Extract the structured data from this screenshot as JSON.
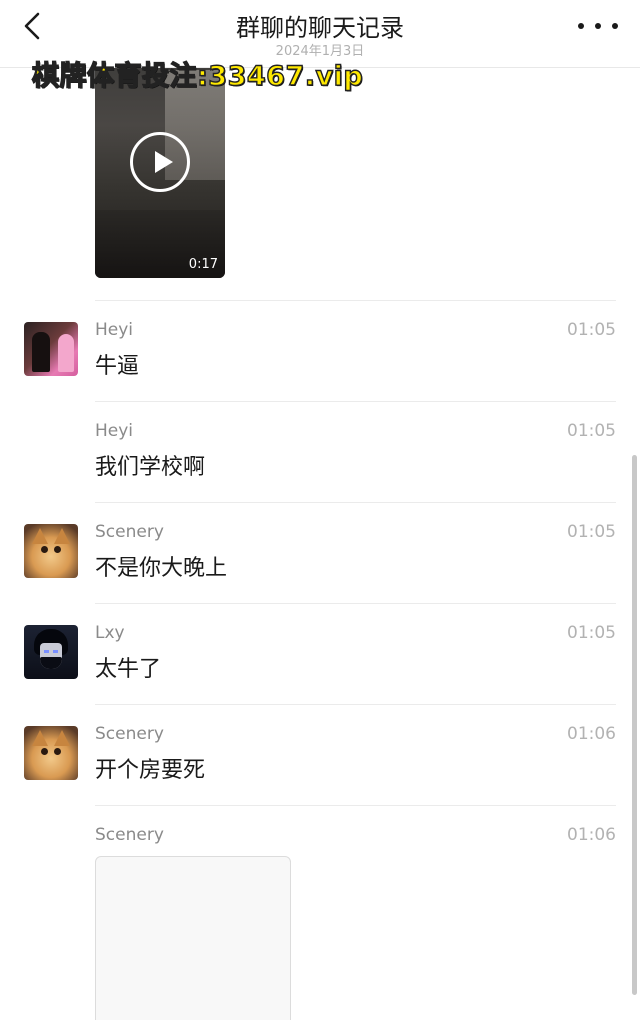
{
  "header": {
    "title": "群聊的聊天记录",
    "subtitle": "2024年1月3日",
    "back_icon": "chevron-left-icon",
    "more_icon": "more-dots-icon"
  },
  "watermark": "棋牌体育投注:33467.vip",
  "video": {
    "duration": "0:17",
    "play_icon": "play-icon"
  },
  "messages": [
    {
      "sender": "Heyi",
      "time": "01:05",
      "text": "牛逼",
      "avatar": "heyi"
    },
    {
      "sender": "Heyi",
      "time": "01:05",
      "text": "我们学校啊"
    },
    {
      "sender": "Scenery",
      "time": "01:05",
      "text": "不是你大晚上",
      "avatar": "scenery"
    },
    {
      "sender": "Lxy",
      "time": "01:05",
      "text": "太牛了",
      "avatar": "lxy"
    },
    {
      "sender": "Scenery",
      "time": "01:06",
      "text": "开个房要死",
      "avatar": "scenery"
    },
    {
      "sender": "Scenery",
      "time": "01:06",
      "text": ""
    }
  ],
  "colors": {
    "background": "#ffffff",
    "secondary_text": "#8a8a8a",
    "time_text": "#b2b2b2",
    "watermark": "#ffe900"
  }
}
